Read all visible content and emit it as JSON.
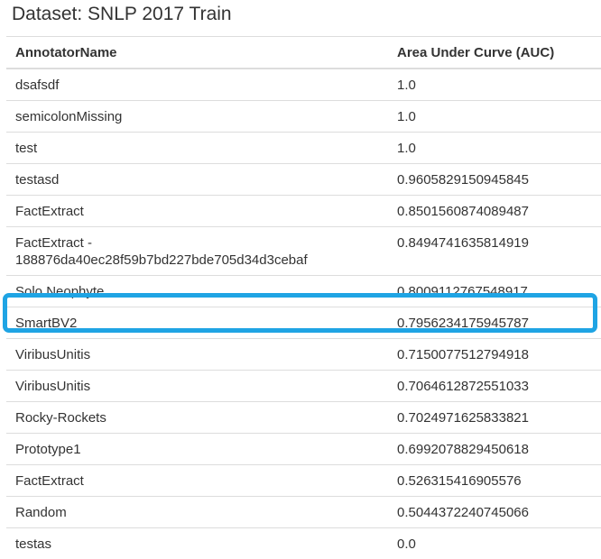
{
  "page": {
    "title": "Dataset: SNLP 2017 Train"
  },
  "table": {
    "headers": {
      "name": "AnnotatorName",
      "auc": "Area Under Curve (AUC)"
    },
    "rows": [
      {
        "name": "dsafsdf",
        "auc": "1.0"
      },
      {
        "name": "semicolonMissing",
        "auc": "1.0"
      },
      {
        "name": "test",
        "auc": "1.0"
      },
      {
        "name": "testasd",
        "auc": "0.9605829150945845"
      },
      {
        "name": "FactExtract",
        "auc": "0.8501560874089487"
      },
      {
        "name": "FactExtract - 188876da40ec28f59b7bd227bde705d34d3cebaf",
        "auc": "0.8494741635814919"
      },
      {
        "name": "Solo Neophyte",
        "auc": "0.8009112767548917"
      },
      {
        "name": "SmartBV2",
        "auc": "0.7956234175945787"
      },
      {
        "name": "ViribusUnitis",
        "auc": "0.7150077512794918"
      },
      {
        "name": "ViribusUnitis",
        "auc": "0.7064612872551033"
      },
      {
        "name": "Rocky-Rockets",
        "auc": "0.7024971625833821"
      },
      {
        "name": "Prototype1",
        "auc": "0.6992078829450618"
      },
      {
        "name": "FactExtract",
        "auc": "0.526315416905576"
      },
      {
        "name": "Random",
        "auc": "0.5044372240745066"
      },
      {
        "name": "testas",
        "auc": "0.0"
      }
    ]
  },
  "highlight": {
    "row_index": 7,
    "color": "#1fa4e4"
  }
}
